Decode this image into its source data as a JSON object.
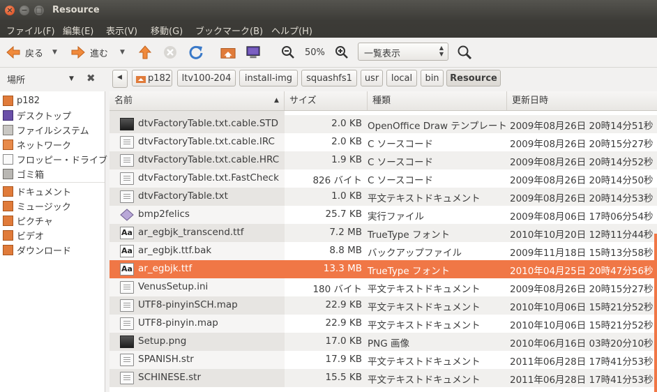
{
  "window": {
    "title": "Resource"
  },
  "menu": [
    "ファイル(F)",
    "編集(E)",
    "表示(V)",
    "移動(G)",
    "ブックマーク(B)",
    "ヘルプ(H)"
  ],
  "toolbar": {
    "back_label": "戻る",
    "forward_label": "進む",
    "zoom_level": "50%",
    "view_mode": "一覧表示"
  },
  "places": {
    "header": "場所"
  },
  "breadcrumbs": [
    "p182",
    "ltv100-204",
    "install-img",
    "squashfs1",
    "usr",
    "local",
    "bin",
    "Resource"
  ],
  "sidebar": {
    "items": [
      {
        "label": "p182",
        "icon": "home-folder-icon"
      },
      {
        "label": "デスクトップ",
        "icon": "desktop-icon"
      },
      {
        "label": "ファイルシステム",
        "icon": "harddisk-icon"
      },
      {
        "label": "ネットワーク",
        "icon": "network-icon"
      },
      {
        "label": "フロッピー・ドライブ",
        "icon": "floppy-icon"
      },
      {
        "label": "ゴミ箱",
        "icon": "trash-icon"
      }
    ],
    "bookmarks": [
      {
        "label": "ドキュメント",
        "icon": "documents-folder-icon"
      },
      {
        "label": "ミュージック",
        "icon": "music-folder-icon"
      },
      {
        "label": "ピクチャ",
        "icon": "pictures-folder-icon"
      },
      {
        "label": "ビデオ",
        "icon": "videos-folder-icon"
      },
      {
        "label": "ダウンロード",
        "icon": "downloads-folder-icon"
      }
    ]
  },
  "columns": {
    "name": "名前",
    "size": "サイズ",
    "type": "種類",
    "modified": "更新日時"
  },
  "files": [
    {
      "name": "dtvFactoryTable.txt.cable.STD",
      "size": "2.0 KB",
      "type": "OpenOffice Draw テンプレート",
      "modified": "2009年08月26日 20時14分51秒",
      "icon": "draw-template-icon"
    },
    {
      "name": "dtvFactoryTable.txt.cable.IRC",
      "size": "2.0 KB",
      "type": "C ソースコード",
      "modified": "2009年08月26日 20時15分27秒",
      "icon": "c-source-icon"
    },
    {
      "name": "dtvFactoryTable.txt.cable.HRC",
      "size": "1.9 KB",
      "type": "C ソースコード",
      "modified": "2009年08月26日 20時14分52秒",
      "icon": "c-source-icon"
    },
    {
      "name": "dtvFactoryTable.txt.FastCheck",
      "size": "826 バイト",
      "type": "C ソースコード",
      "modified": "2009年08月26日 20時14分50秒",
      "icon": "c-source-icon"
    },
    {
      "name": "dtvFactoryTable.txt",
      "size": "1.0 KB",
      "type": "平文テキストドキュメント",
      "modified": "2009年08月26日 20時14分53秒",
      "icon": "text-file-icon"
    },
    {
      "name": "bmp2felics",
      "size": "25.7 KB",
      "type": "実行ファイル",
      "modified": "2009年08月06日 17時06分54秒",
      "icon": "executable-icon"
    },
    {
      "name": "ar_egbjk_transcend.ttf",
      "size": "7.2 MB",
      "type": "TrueType フォント",
      "modified": "2010年10月20日 12時11分44秒",
      "icon": "font-file-icon"
    },
    {
      "name": "ar_egbjk.ttf.bak",
      "size": "8.8 MB",
      "type": "バックアップファイル",
      "modified": "2009年11月18日 15時13分58秒",
      "icon": "font-file-icon"
    },
    {
      "name": "ar_egbjk.ttf",
      "size": "13.3 MB",
      "type": "TrueType フォント",
      "modified": "2010年04月25日 20時47分56秒",
      "icon": "font-file-icon",
      "selected": true
    },
    {
      "name": "VenusSetup.ini",
      "size": "180 バイト",
      "type": "平文テキストドキュメント",
      "modified": "2009年08月26日 20時15分27秒",
      "icon": "text-file-icon"
    },
    {
      "name": "UTF8-pinyinSCH.map",
      "size": "22.9 KB",
      "type": "平文テキストドキュメント",
      "modified": "2010年10月06日 15時21分52秒",
      "icon": "text-file-icon"
    },
    {
      "name": "UTF8-pinyin.map",
      "size": "22.9 KB",
      "type": "平文テキストドキュメント",
      "modified": "2010年10月06日 15時21分52秒",
      "icon": "text-file-icon"
    },
    {
      "name": "Setup.png",
      "size": "17.0 KB",
      "type": "PNG 画像",
      "modified": "2010年06月16日 03時20分10秒",
      "icon": "image-file-icon"
    },
    {
      "name": "SPANISH.str",
      "size": "17.9 KB",
      "type": "平文テキストドキュメント",
      "modified": "2011年06月28日 17時41分53秒",
      "icon": "text-file-icon"
    },
    {
      "name": "SCHINESE.str",
      "size": "15.5 KB",
      "type": "平文テキストドキュメント",
      "modified": "2011年06月28日 17時41分53秒",
      "icon": "text-file-icon"
    }
  ],
  "colors": {
    "selection": "#f07746",
    "titlebar": "#3c3b37",
    "accent_orange": "#f07746"
  }
}
